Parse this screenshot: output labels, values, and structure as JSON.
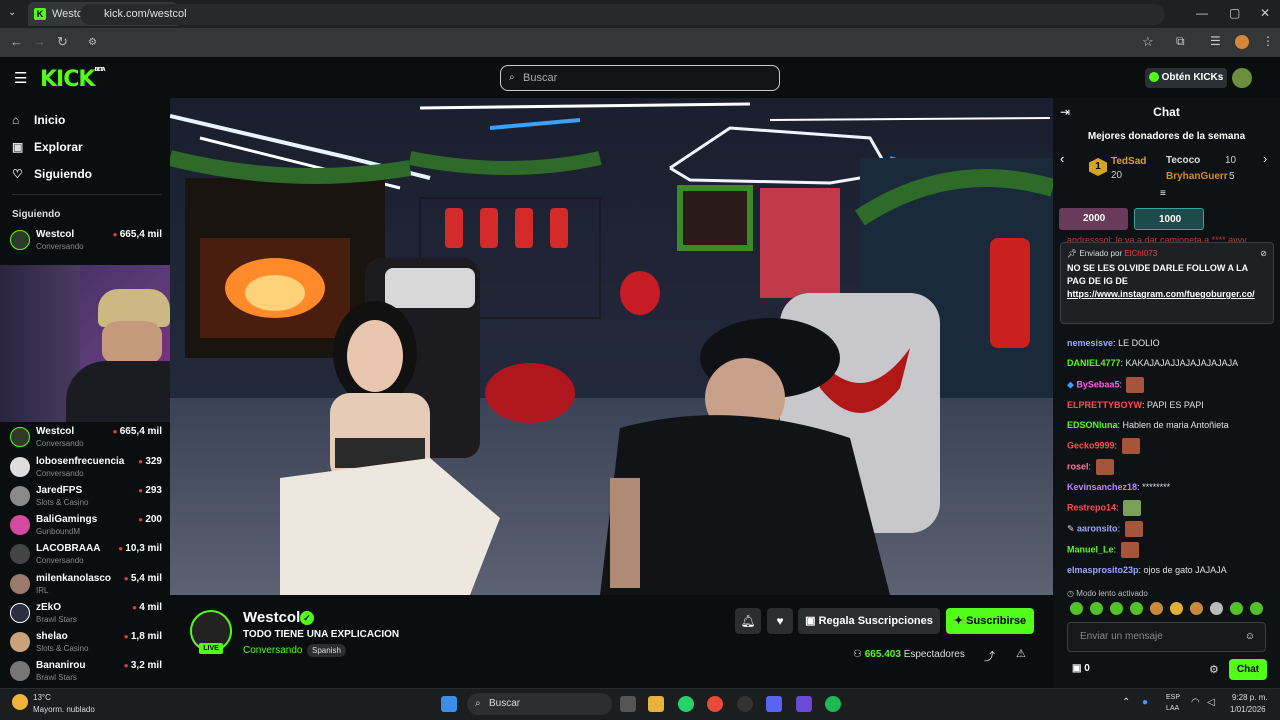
{
  "browser": {
    "tab_title": "Westcol Stream - Watch Li...",
    "url": "kick.com/westcol"
  },
  "header": {
    "logo": "KICK",
    "logo_badge": "BETA",
    "search_placeholder": "Buscar",
    "get_kicks": "Obtén KICKs"
  },
  "sidebar": {
    "nav": [
      {
        "label": "Inicio",
        "icon": "home-icon"
      },
      {
        "label": "Explorar",
        "icon": "explore-icon"
      },
      {
        "label": "Siguiendo",
        "icon": "heart-icon"
      }
    ],
    "following_label": "Siguiendo",
    "following_top": {
      "name": "Westcol",
      "category": "Conversando",
      "viewers": "665,4 mil"
    },
    "following": [
      {
        "name": "Westcol",
        "category": "Conversando",
        "viewers": "665,4 mil"
      },
      {
        "name": "lobosenfrecuencia",
        "category": "Conversando",
        "viewers": "329"
      },
      {
        "name": "JaredFPS",
        "category": "Slots & Casino",
        "viewers": "293"
      },
      {
        "name": "BaliGamings",
        "category": "GunboundM",
        "viewers": "200"
      },
      {
        "name": "LACOBRAAA",
        "category": "Conversando",
        "viewers": "10,3 mil"
      },
      {
        "name": "milenkanolasco",
        "category": "IRL",
        "viewers": "5,4 mil"
      },
      {
        "name": "zEkO",
        "category": "Brawl Stars",
        "viewers": "4 mil"
      },
      {
        "name": "shelao",
        "category": "Slots & Casino",
        "viewers": "1,8 mil"
      },
      {
        "name": "Bananirou",
        "category": "Brawl Stars",
        "viewers": "3,2 mil"
      }
    ]
  },
  "stream": {
    "channel": "Westcol",
    "live_badge": "LIVE",
    "title": "TODO TIENE UNA EXPLICACION",
    "category": "Conversando",
    "language": "Spanish",
    "gift_label": "Regala Suscripciones",
    "subscribe_label": "Suscribirse",
    "viewers_count": "665.403",
    "viewers_label": "Espectadores"
  },
  "chat": {
    "title": "Chat",
    "donors_title": "Mejores donadores de la semana",
    "donors": [
      {
        "rank": "1",
        "name": "TedSad",
        "amount": "20"
      },
      {
        "name": "Tecoco",
        "amount": "10"
      },
      {
        "name": "BryhanGuerr",
        "amount": "5"
      }
    ],
    "pinned_bars": [
      "2000",
      "1000"
    ],
    "pinned": {
      "by_label": "Enviado por",
      "by_user": "ElChI073",
      "text": "NO SE LES OLVIDE DARLE FOLLOW A LA PAG DE IG DE",
      "link": "https://www.instagram.com/fuegoburger.co/"
    },
    "partial_top": "andresssol: le va a dar camioneta a **** ayyy",
    "messages": [
      {
        "user": "nemesisve",
        "color": "#9aa7ff",
        "text": "LE DOLIO",
        "emote": false
      },
      {
        "user": "DANIEL4777",
        "color": "#53fc18",
        "text": "KAKAJAJAJJAJAJAJAJAJA",
        "emote": false
      },
      {
        "user": "BySebaa5",
        "color": "#ff5cf0",
        "text": "",
        "emote": true
      },
      {
        "user": "ELPRETTYBOYW",
        "color": "#ff4d4d",
        "text": "PAPI ES PAPI",
        "emote": false
      },
      {
        "user": "EDSONluna",
        "color": "#53fc18",
        "text": "Hablen de maria Antoñieta",
        "emote": false
      },
      {
        "user": "Gecko9999",
        "color": "#ff4d4d",
        "text": "",
        "emote": true
      },
      {
        "user": "rosel",
        "color": "#ff7aa0",
        "text": "",
        "emote": true
      },
      {
        "user": "Kevinsanchez18",
        "color": "#b985ff",
        "text": "********",
        "emote": false
      },
      {
        "user": "Restrepo14",
        "color": "#ff4d4d",
        "text": "",
        "emote": true
      },
      {
        "user": "aaronsito",
        "color": "#9aa7ff",
        "text": "",
        "emote": true
      },
      {
        "user": "Manuel_Le",
        "color": "#53fc18",
        "text": "",
        "emote": true
      },
      {
        "user": "elmasprosito23p",
        "color": "#9aa7ff",
        "text": "ojos de gato JAJAJA",
        "emote": false
      }
    ],
    "slow_mode": "Modo lento activado",
    "input_placeholder": "Enviar un mensaje",
    "points": "0",
    "send_label": "Chat"
  },
  "taskbar": {
    "temperature": "13°C",
    "weather": "Mayorm. nublado",
    "search": "Buscar",
    "lang_top": "ESP",
    "lang_bottom": "LAA",
    "time": "9:28 p. m.",
    "date": "1/01/2026"
  }
}
